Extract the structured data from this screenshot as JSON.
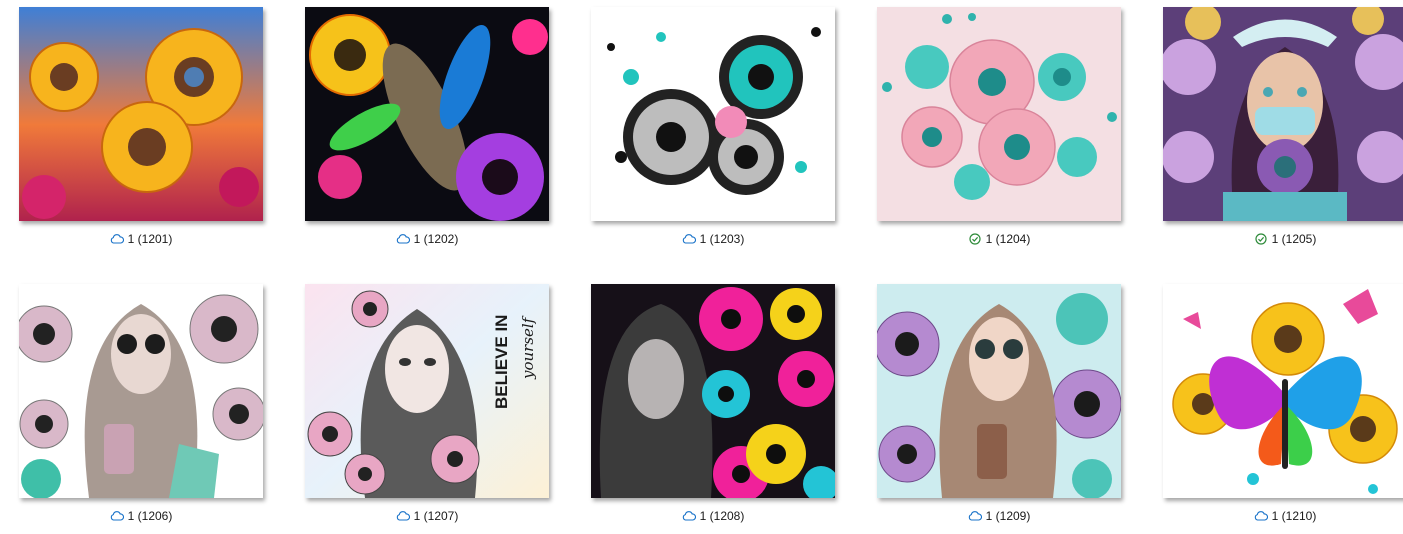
{
  "files": [
    {
      "name": "1 (1201)",
      "status": "cloud-icon",
      "art": "sunflowers-colorful-field"
    },
    {
      "name": "1 (1202)",
      "status": "cloud-icon",
      "art": "neon-sunflowers-feathers"
    },
    {
      "name": "1 (1203)",
      "status": "cloud-icon",
      "art": "bw-teal-sunflowers"
    },
    {
      "name": "1 (1204)",
      "status": "synced-check-icon",
      "art": "pastel-teal-pink-flowers"
    },
    {
      "name": "1 (1205)",
      "status": "synced-check-icon",
      "art": "nurse-purple-sunflowers"
    },
    {
      "name": "1 (1206)",
      "status": "cloud-icon",
      "art": "girl-sunglasses-iced-coffee"
    },
    {
      "name": "1 (1207)",
      "status": "cloud-icon",
      "art": "girl-believe-in-yourself",
      "art_text": [
        "BELIEVE IN",
        "yourself"
      ]
    },
    {
      "name": "1 (1208)",
      "status": "cloud-icon",
      "art": "girl-neon-rainbow-sunflowers"
    },
    {
      "name": "1 (1209)",
      "status": "cloud-icon",
      "art": "girl-pastel-teal-sunflowers"
    },
    {
      "name": "1 (1210)",
      "status": "cloud-icon",
      "art": "rainbow-butterfly-sunflowers"
    }
  ],
  "colors": {
    "cloud": "#1a73c9",
    "check": "#2e8b3a"
  }
}
